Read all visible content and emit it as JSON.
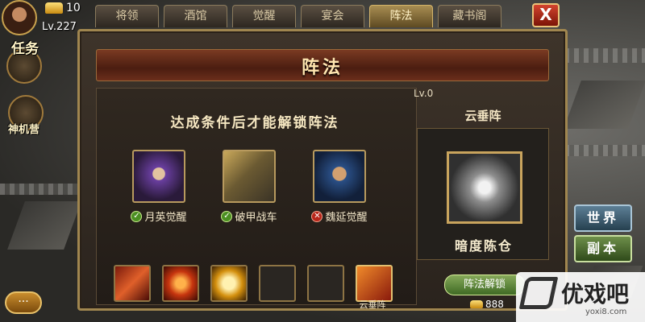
{
  "player": {
    "gold": "10",
    "level": "Lv.227"
  },
  "side": {
    "task_label": "任务",
    "camp_label": "神机营",
    "chat_label": "···"
  },
  "tabs": [
    {
      "label": "将领"
    },
    {
      "label": "酒馆"
    },
    {
      "label": "觉醒"
    },
    {
      "label": "宴会"
    },
    {
      "label": "阵法",
      "active": true
    },
    {
      "label": "藏书阁"
    }
  ],
  "close_label": "X",
  "panel": {
    "title": "阵法",
    "condition_title": "达成条件后才能解锁阵法",
    "conditions": [
      {
        "label": "月英觉醒",
        "status": "ok"
      },
      {
        "label": "破甲战车",
        "status": "ok"
      },
      {
        "label": "魏延觉醒",
        "status": "no"
      }
    ],
    "slots": [
      "claw-icon",
      "flame-ring-icon",
      "golden-shield-icon",
      "locked-chest-icon",
      "locked-chest-icon",
      "cloud-formation-icon"
    ],
    "selected_slot_label": "云垂阵"
  },
  "formation": {
    "level": "Lv.0",
    "name": "云垂阵",
    "sub_name": "暗度陈仓",
    "unlock_button": "阵法解锁",
    "cost": "888"
  },
  "world_button": "世界",
  "dungeon_button": "副本",
  "watermark": {
    "text": "优戏吧",
    "url": "yoxi8.com"
  },
  "colors": {
    "accent": "#a0864f",
    "ok": "#4b8f22",
    "no": "#b8261a"
  }
}
